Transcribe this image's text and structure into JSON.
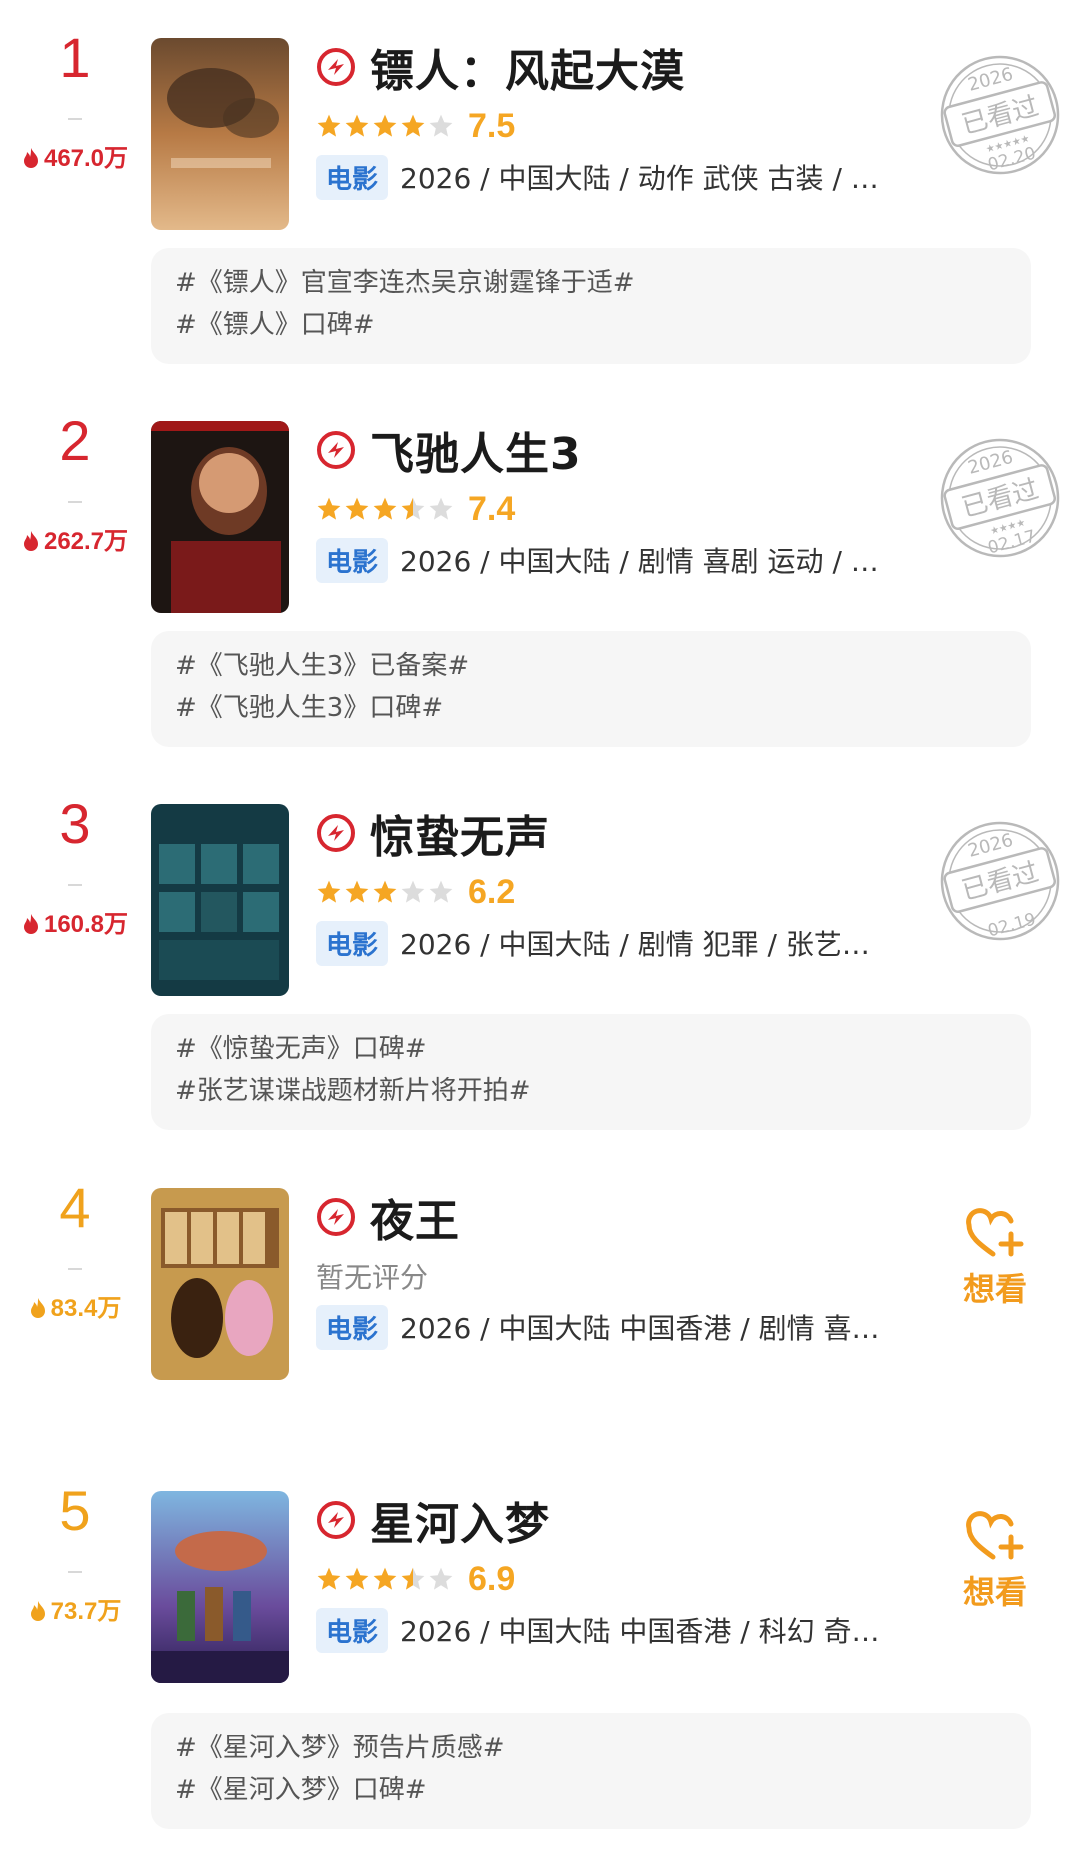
{
  "colors": {
    "red": "#d7262f",
    "orange": "#f0a21c",
    "star": "#f5a623",
    "tag_bg": "#e6f0fb",
    "tag_text": "#2b73cf"
  },
  "entries": [
    {
      "rank": "1",
      "heat": "467.0万",
      "title": "镖人：风起大漠",
      "stars_filled": 4,
      "stars_half": 0,
      "score": "7.5",
      "type_tag": "电影",
      "meta": "2026 / 中国大陆 / 动作 武侠 古装 / …",
      "badge": "stamp",
      "stamp_year": "2026",
      "stamp_text": "已看过",
      "stamp_date": "02.20",
      "topics": [
        "#《镖人》官宣李连杰吴京谢霆锋于适#",
        "#《镖人》口碑#"
      ]
    },
    {
      "rank": "2",
      "heat": "262.7万",
      "title": "飞驰人生3",
      "stars_filled": 3,
      "stars_half": 1,
      "score": "7.4",
      "type_tag": "电影",
      "meta": "2026 / 中国大陆 / 剧情 喜剧 运动 / …",
      "badge": "stamp",
      "stamp_year": "2026",
      "stamp_text": "已看过",
      "stamp_date": "02.17",
      "topics": [
        "#《飞驰人生3》已备案#",
        "#《飞驰人生3》口碑#"
      ]
    },
    {
      "rank": "3",
      "heat": "160.8万",
      "title": "惊蛰无声",
      "stars_filled": 3,
      "stars_half": 0,
      "score": "6.2",
      "type_tag": "电影",
      "meta": "2026 / 中国大陆 / 剧情 犯罪 / 张艺…",
      "badge": "stamp",
      "stamp_year": "2026",
      "stamp_text": "已看过",
      "stamp_date": "02.19",
      "topics": [
        "#《惊蛰无声》口碑#",
        "#张艺谋谍战题材新片将开拍#"
      ]
    },
    {
      "rank": "4",
      "heat": "83.4万",
      "title": "夜王",
      "no_rating": "暂无评分",
      "type_tag": "电影",
      "meta": "2026 / 中国大陆 中国香港 / 剧情 喜…",
      "badge": "want",
      "want_label": "想看",
      "topics": []
    },
    {
      "rank": "5",
      "heat": "73.7万",
      "title": "星河入梦",
      "stars_filled": 3,
      "stars_half": 1,
      "score": "6.9",
      "type_tag": "电影",
      "meta": "2026 / 中国大陆 中国香港 / 科幻 奇…",
      "badge": "want",
      "want_label": "想看",
      "topics": [
        "#《星河入梦》预告片质感#",
        "#《星河入梦》口碑#"
      ]
    }
  ]
}
